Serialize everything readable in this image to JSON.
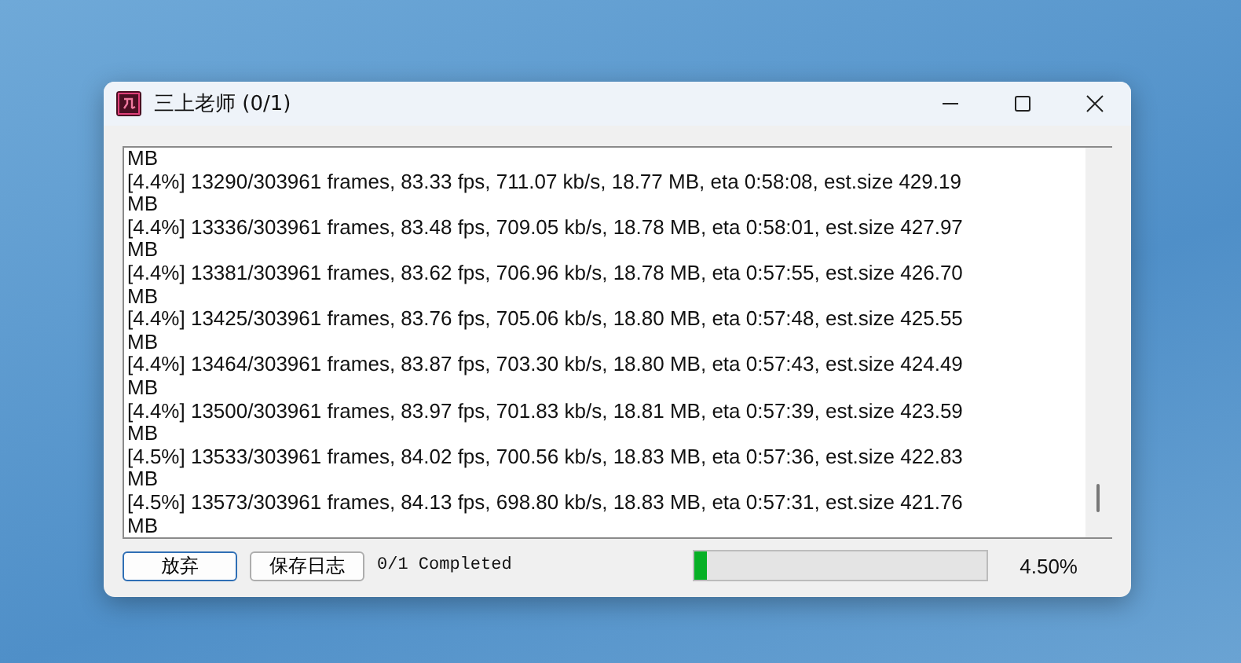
{
  "window": {
    "title": "三上老师 (0/1)"
  },
  "log": {
    "lines": [
      "MB",
      "[4.4%] 13290/303961 frames, 83.33 fps, 711.07 kb/s, 18.77 MB, eta 0:58:08, est.size 429.19",
      "MB",
      "[4.4%] 13336/303961 frames, 83.48 fps, 709.05 kb/s, 18.78 MB, eta 0:58:01, est.size 427.97",
      "MB",
      "[4.4%] 13381/303961 frames, 83.62 fps, 706.96 kb/s, 18.78 MB, eta 0:57:55, est.size 426.70",
      "MB",
      "[4.4%] 13425/303961 frames, 83.76 fps, 705.06 kb/s, 18.80 MB, eta 0:57:48, est.size 425.55",
      "MB",
      "[4.4%] 13464/303961 frames, 83.87 fps, 703.30 kb/s, 18.80 MB, eta 0:57:43, est.size 424.49",
      "MB",
      "[4.4%] 13500/303961 frames, 83.97 fps, 701.83 kb/s, 18.81 MB, eta 0:57:39, est.size 423.59",
      "MB",
      "[4.5%] 13533/303961 frames, 84.02 fps, 700.56 kb/s, 18.83 MB, eta 0:57:36, est.size 422.83",
      "MB",
      "[4.5%] 13573/303961 frames, 84.13 fps, 698.80 kb/s, 18.83 MB, eta 0:57:31, est.size 421.76",
      "MB"
    ]
  },
  "buttons": [
    {
      "label": "放弃",
      "selected": true
    },
    {
      "label": "保存日志",
      "selected": false
    }
  ],
  "status": "0/1 Completed",
  "progress": {
    "level": 0.045,
    "reading": "4.50%"
  }
}
